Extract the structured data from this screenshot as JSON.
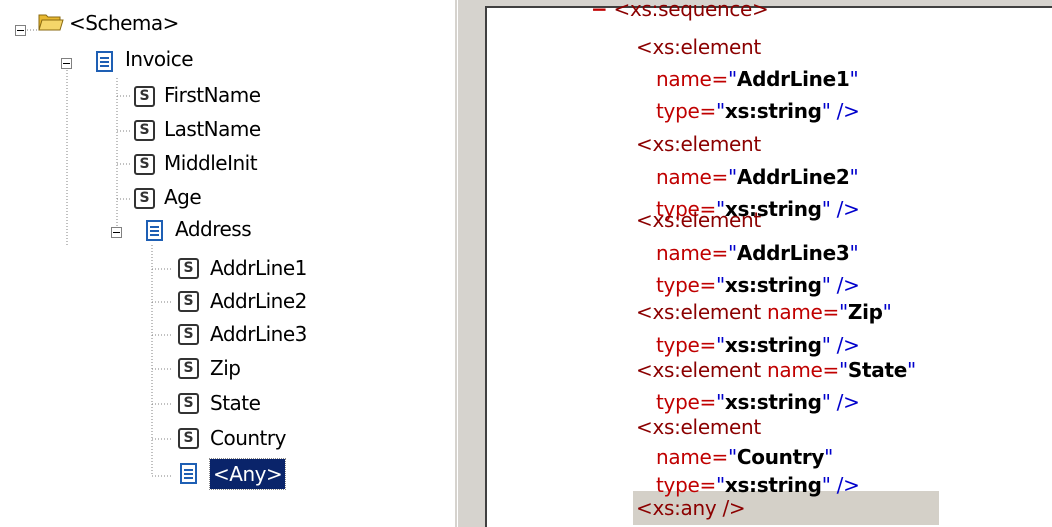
{
  "tree": {
    "root": {
      "label": "<Schema>",
      "icon": "folder-open-icon"
    },
    "invoice": {
      "label": "Invoice",
      "icon": "document-icon"
    },
    "invoice_children": [
      "FirstName",
      "LastName",
      "MiddleInit",
      "Age"
    ],
    "address": {
      "label": "Address",
      "icon": "document-icon"
    },
    "address_children": [
      "AddrLine1",
      "AddrLine2",
      "AddrLine3",
      "Zip",
      "State",
      "Country"
    ],
    "any": {
      "label": "<Any>",
      "selected": true
    }
  },
  "xml": {
    "collapse_marker": "−",
    "first_line": "<xs:sequence>",
    "el_open": "<xs:element",
    "name_attr": "name=",
    "type_attr": "type=",
    "q": "\"",
    "close": " />",
    "string_type": "xs:string",
    "names": [
      "AddrLine1",
      "AddrLine2",
      "AddrLine3",
      "Zip",
      "State",
      "Country"
    ],
    "last_line": "<xs:any />"
  },
  "colors": {
    "tag": "#8b0000",
    "attr": "#c00000",
    "punct": "#0000cc",
    "selection": "#0a246a"
  }
}
